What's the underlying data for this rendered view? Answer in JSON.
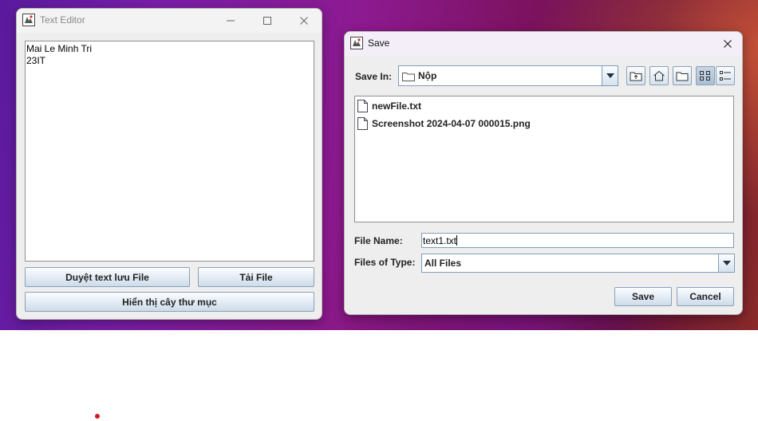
{
  "editor": {
    "title": "Text Editor",
    "text_lines": [
      "Mai Le Minh Tri",
      "23IT"
    ],
    "buttons": {
      "browse_save": "Duyệt text lưu File",
      "load_file": "Tải File",
      "show_tree": "Hiển thị cây thư mục"
    }
  },
  "save_dialog": {
    "title": "Save",
    "save_in_label": "Save In:",
    "save_in_value": "Nộp",
    "files": [
      {
        "name": "newFile.txt"
      },
      {
        "name": "Screenshot 2024-04-07 000015.png"
      }
    ],
    "file_name_label": "File Name:",
    "file_name_value": "text1.txt",
    "file_type_label": "Files of Type:",
    "file_type_value": "All Files",
    "save_button": "Save",
    "cancel_button": "Cancel",
    "toolbar_icons": [
      "up-folder-icon",
      "home-icon",
      "new-folder-icon",
      "list-view-icon",
      "details-view-icon"
    ]
  },
  "colors": {
    "accent_border": "#7f9db9",
    "button_gradient_top": "#fbfdff",
    "button_gradient_bottom": "#cddbe9"
  }
}
